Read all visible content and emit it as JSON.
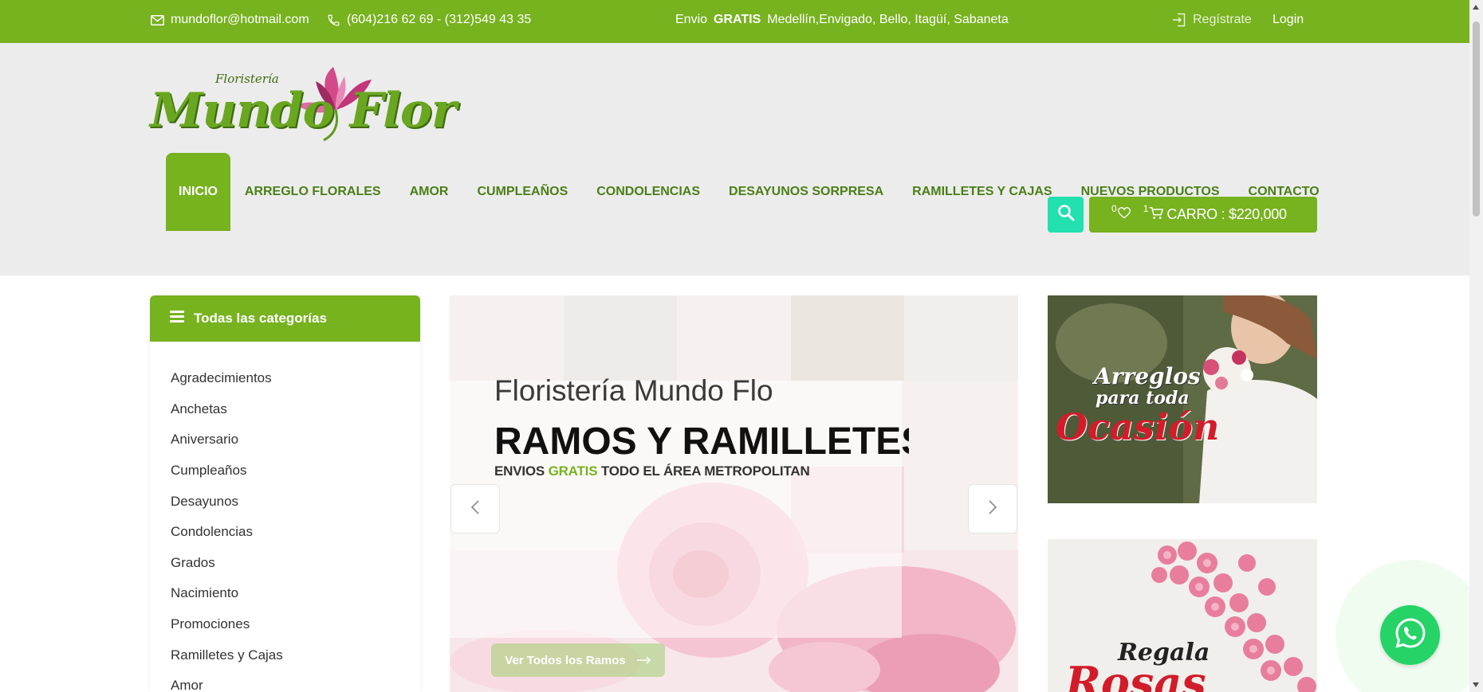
{
  "topbar": {
    "email": "mundoflor@hotmail.com",
    "phone": "(604)216 62 69 - (312)549 43 35",
    "envio_prefix": "Envio",
    "envio_bold": "GRATIS",
    "envio_suffix": "Medellín,Envigado, Bello, Itagüí, Sabaneta",
    "register": "Regístrate",
    "login": "Login",
    "icons": [
      "mail-icon",
      "phone-icon",
      "login-icon"
    ]
  },
  "logo": {
    "subtitle": "Floristería",
    "brand": "Mundo Flor"
  },
  "nav": {
    "items": [
      {
        "label": "INICIO",
        "active": true
      },
      {
        "label": "ARREGLO FLORALES"
      },
      {
        "label": "AMOR"
      },
      {
        "label": "CUMPLEAÑOS"
      },
      {
        "label": "CONDOLENCIAS"
      },
      {
        "label": "DESAYUNOS SORPRESA"
      },
      {
        "label": "RAMILLETES Y CAJAS"
      },
      {
        "label": "NUEVOS PRODUCTOS"
      },
      {
        "label": "CONTACTO"
      }
    ]
  },
  "cart": {
    "wishlist_count": "0",
    "cart_count": "1",
    "label": "CARRO : $220,000"
  },
  "sidebar": {
    "title": "Todas las categorías",
    "categories": [
      "Agradecimientos",
      "Anchetas",
      "Aniversario",
      "Cumpleaños",
      "Desayunos",
      "Condolencias",
      "Grados",
      "Nacimiento",
      "Promociones",
      "Ramilletes y Cajas",
      "Amor"
    ]
  },
  "slider": {
    "line1": "Floristería Mundo Flo",
    "line2": "RAMOS Y RAMILLETES",
    "line3_prefix": "ENVIOS",
    "line3_green": "GRATIS",
    "line3_suffix": "TODO EL ÁREA METROPOLITAN",
    "button": "Ver Todos los Ramos"
  },
  "banners": {
    "banner1": {
      "line1": "Arreglos",
      "line2": "para toda",
      "line3": "Ocasión"
    },
    "banner2": {
      "line1": "Regala",
      "line2": "Rosas"
    }
  },
  "colors": {
    "brand_green": "#77b21f",
    "nav_text": "#4a7f16",
    "search_teal": "#23e0b0",
    "whatsapp": "#25d366",
    "header_bg": "#ececec"
  }
}
